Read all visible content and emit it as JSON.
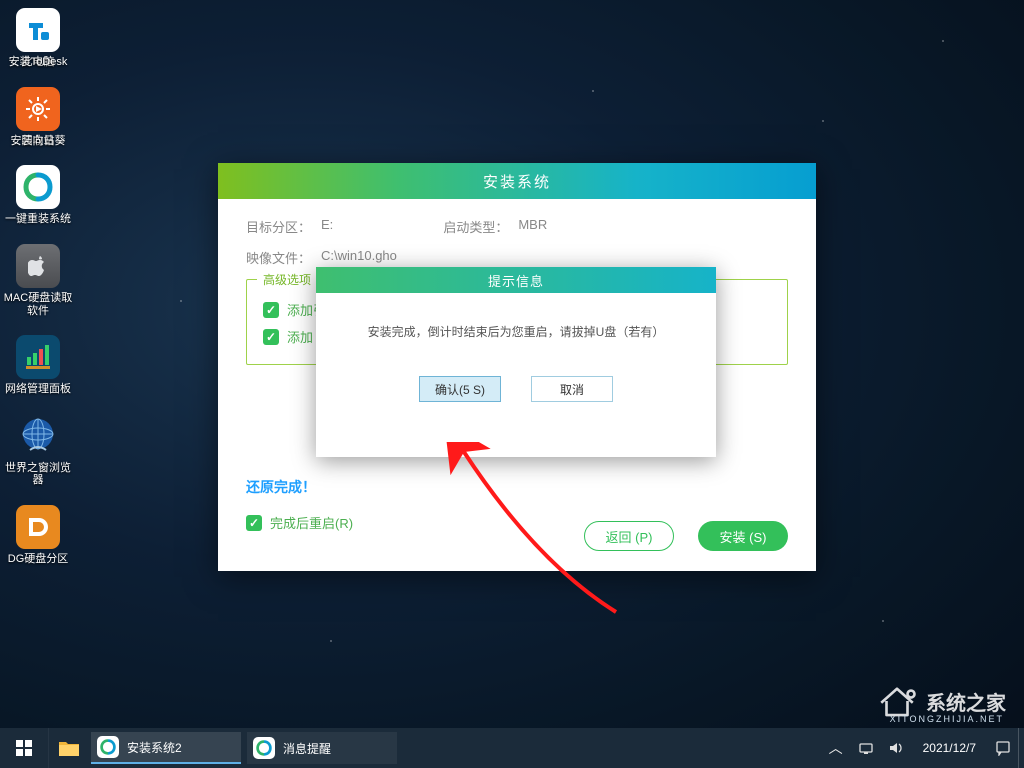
{
  "desktop": {
    "col1": [
      {
        "name": "this-pc",
        "label": "此电脑"
      },
      {
        "name": "recycle-bin",
        "label": "回收站"
      },
      {
        "name": "onekey-reinstall",
        "label": "一键重装系统"
      },
      {
        "name": "mac-disk-reader",
        "label": "MAC硬盘读取软件"
      },
      {
        "name": "network-manager",
        "label": "网络管理面板"
      },
      {
        "name": "world-window-browser",
        "label": "世界之窗浏览器"
      },
      {
        "name": "dg-partition",
        "label": "DG硬盘分区"
      }
    ],
    "col2": [
      {
        "name": "install-todesk",
        "label": "安装ToDesk"
      },
      {
        "name": "install-sunflower",
        "label": "安装向日葵"
      }
    ]
  },
  "installer": {
    "title": "安装系统",
    "target_partition_label": "目标分区：",
    "target_partition_value": "E:",
    "boot_type_label": "启动类型：",
    "boot_type_value": "MBR",
    "image_file_label": "映像文件：",
    "image_file_value": "C:\\win10.gho",
    "advanced_legend": "高级选项",
    "chk1": "添加引",
    "chk2": "添加",
    "status": "还原完成！",
    "restart_label": "完成后重启(R)",
    "btn_back": "返回 (P)",
    "btn_install": "安装 (S)"
  },
  "prompt": {
    "title": "提示信息",
    "message": "安装完成，倒计时结束后为您重启，请拔掉U盘（若有）",
    "confirm": "确认(5 S)",
    "cancel": "取消"
  },
  "taskbar": {
    "task1": "安装系统2",
    "task2": "消息提醒",
    "date": "2021/12/7"
  },
  "watermark": {
    "text": "系统之家",
    "sub": "XITONGZHIJIA.NET"
  }
}
